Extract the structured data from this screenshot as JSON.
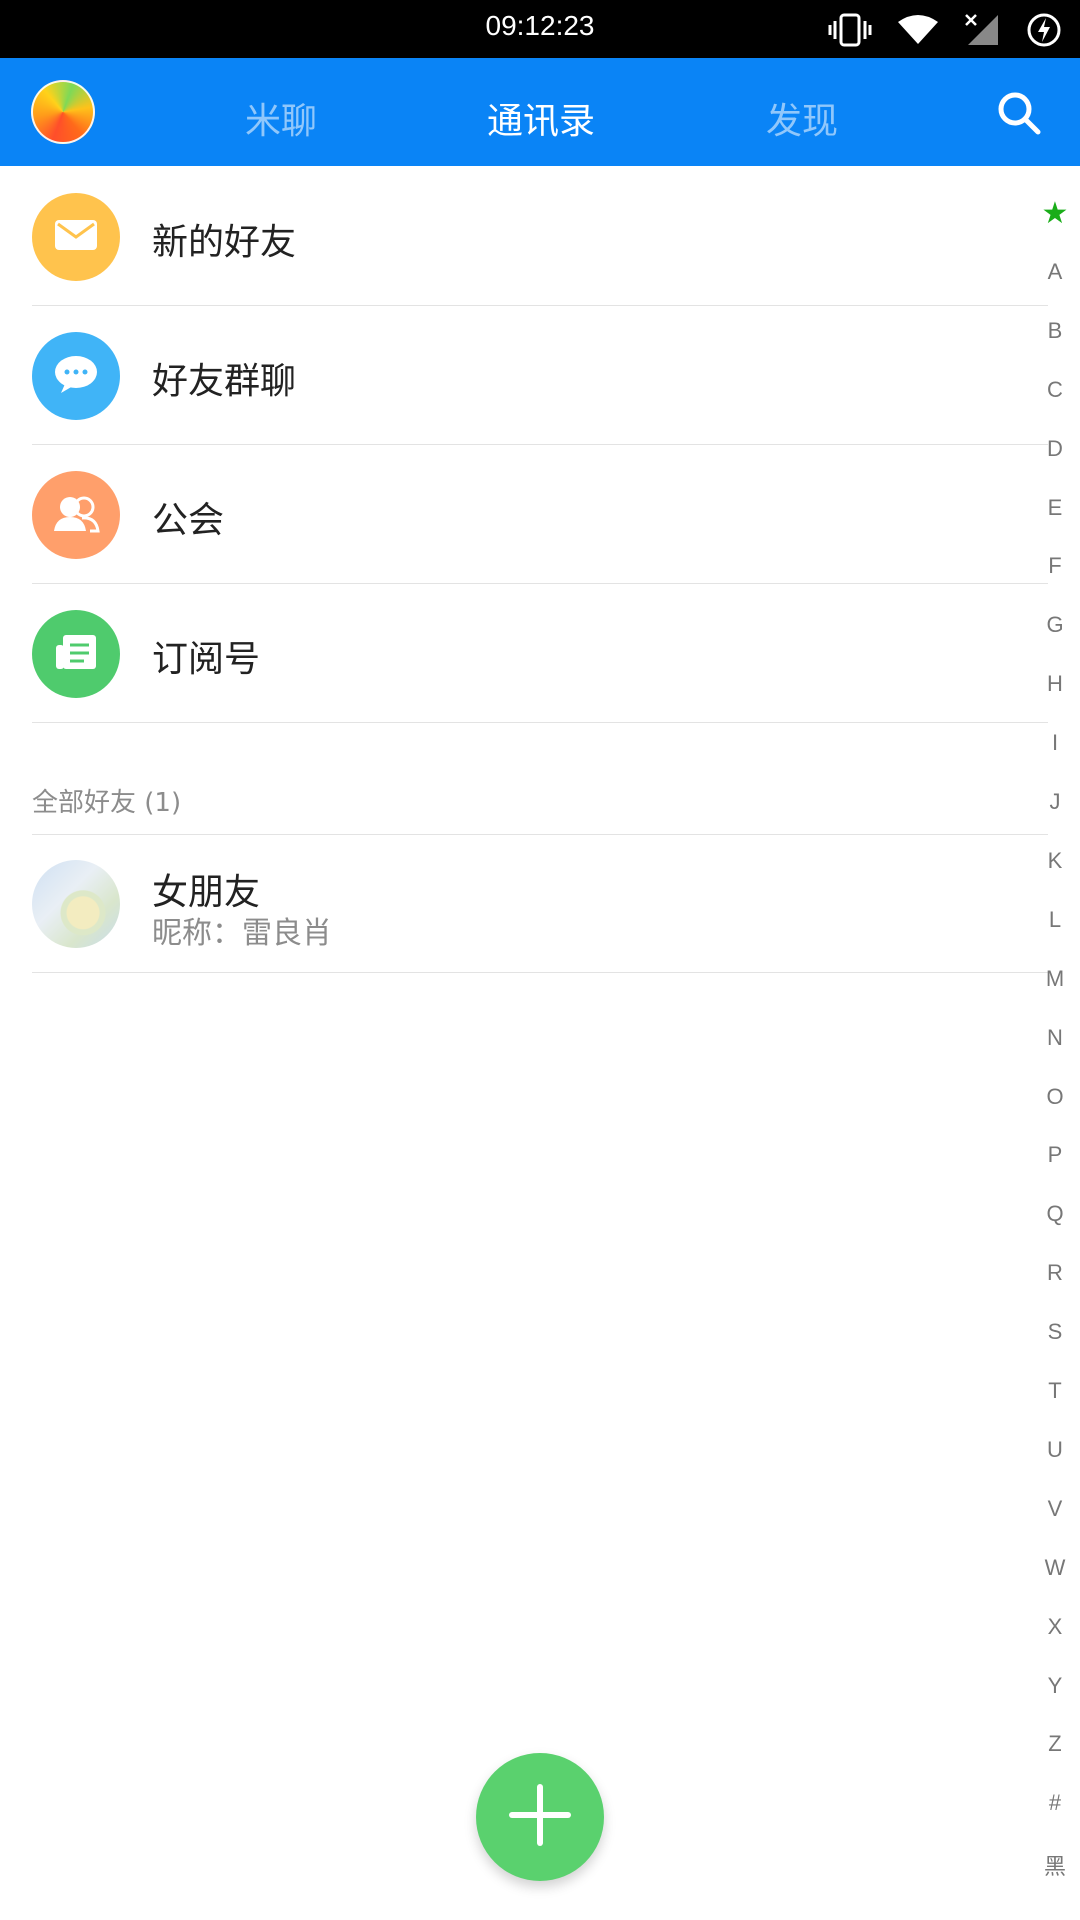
{
  "status_bar": {
    "time": "09:12:23",
    "icons": [
      "vibrate-icon",
      "wifi-icon",
      "signal-icon",
      "battery-charging-icon"
    ]
  },
  "header": {
    "tabs": [
      {
        "label": "米聊",
        "active": false
      },
      {
        "label": "通讯录",
        "active": true
      },
      {
        "label": "发现",
        "active": false
      }
    ],
    "search_icon": "search-icon",
    "accent_color": "#0A84F6"
  },
  "entries": [
    {
      "label": "新的好友",
      "icon": "mail-icon",
      "color": "#FFC34D"
    },
    {
      "label": "好友群聊",
      "icon": "chat-bubble-icon",
      "color": "#40B4F7"
    },
    {
      "label": "公会",
      "icon": "group-icon",
      "color": "#FF9F6B"
    },
    {
      "label": "订阅号",
      "icon": "news-icon",
      "color": "#4FCB6D"
    }
  ],
  "friends_section": {
    "title": "全部好友 (1)",
    "friends": [
      {
        "name": "女朋友",
        "nickname": "昵称：雷良肖"
      }
    ]
  },
  "index_bar": [
    "★",
    "A",
    "B",
    "C",
    "D",
    "E",
    "F",
    "G",
    "H",
    "I",
    "J",
    "K",
    "L",
    "M",
    "N",
    "O",
    "P",
    "Q",
    "R",
    "S",
    "T",
    "U",
    "V",
    "W",
    "X",
    "Y",
    "Z",
    "#",
    "黑"
  ],
  "fab": {
    "icon": "plus-icon",
    "color": "#5AD16E"
  }
}
